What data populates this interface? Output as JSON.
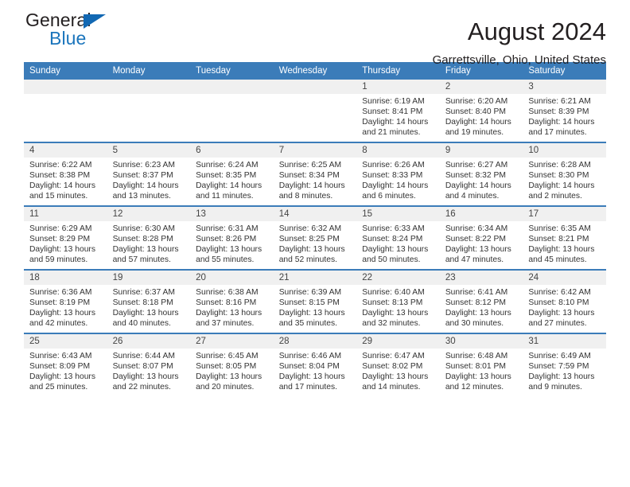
{
  "brand": {
    "name_top": "General",
    "name_bottom": "Blue",
    "color_blue": "#1b75bc",
    "triangle_icon": "triangle-icon"
  },
  "header": {
    "title": "August 2024",
    "subtitle": "Garrettsville, Ohio, United States"
  },
  "calendar": {
    "accent_color": "#3b7cb9",
    "daynum_bg": "#f0f0f0",
    "weekday_headers": [
      "Sunday",
      "Monday",
      "Tuesday",
      "Wednesday",
      "Thursday",
      "Friday",
      "Saturday"
    ],
    "weeks": [
      [
        {
          "day": "",
          "empty": true
        },
        {
          "day": "",
          "empty": true
        },
        {
          "day": "",
          "empty": true
        },
        {
          "day": "",
          "empty": true
        },
        {
          "day": "1",
          "sunrise": "Sunrise: 6:19 AM",
          "sunset": "Sunset: 8:41 PM",
          "daylight_l1": "Daylight: 14 hours",
          "daylight_l2": "and 21 minutes."
        },
        {
          "day": "2",
          "sunrise": "Sunrise: 6:20 AM",
          "sunset": "Sunset: 8:40 PM",
          "daylight_l1": "Daylight: 14 hours",
          "daylight_l2": "and 19 minutes."
        },
        {
          "day": "3",
          "sunrise": "Sunrise: 6:21 AM",
          "sunset": "Sunset: 8:39 PM",
          "daylight_l1": "Daylight: 14 hours",
          "daylight_l2": "and 17 minutes."
        }
      ],
      [
        {
          "day": "4",
          "sunrise": "Sunrise: 6:22 AM",
          "sunset": "Sunset: 8:38 PM",
          "daylight_l1": "Daylight: 14 hours",
          "daylight_l2": "and 15 minutes."
        },
        {
          "day": "5",
          "sunrise": "Sunrise: 6:23 AM",
          "sunset": "Sunset: 8:37 PM",
          "daylight_l1": "Daylight: 14 hours",
          "daylight_l2": "and 13 minutes."
        },
        {
          "day": "6",
          "sunrise": "Sunrise: 6:24 AM",
          "sunset": "Sunset: 8:35 PM",
          "daylight_l1": "Daylight: 14 hours",
          "daylight_l2": "and 11 minutes."
        },
        {
          "day": "7",
          "sunrise": "Sunrise: 6:25 AM",
          "sunset": "Sunset: 8:34 PM",
          "daylight_l1": "Daylight: 14 hours",
          "daylight_l2": "and 8 minutes."
        },
        {
          "day": "8",
          "sunrise": "Sunrise: 6:26 AM",
          "sunset": "Sunset: 8:33 PM",
          "daylight_l1": "Daylight: 14 hours",
          "daylight_l2": "and 6 minutes."
        },
        {
          "day": "9",
          "sunrise": "Sunrise: 6:27 AM",
          "sunset": "Sunset: 8:32 PM",
          "daylight_l1": "Daylight: 14 hours",
          "daylight_l2": "and 4 minutes."
        },
        {
          "day": "10",
          "sunrise": "Sunrise: 6:28 AM",
          "sunset": "Sunset: 8:30 PM",
          "daylight_l1": "Daylight: 14 hours",
          "daylight_l2": "and 2 minutes."
        }
      ],
      [
        {
          "day": "11",
          "sunrise": "Sunrise: 6:29 AM",
          "sunset": "Sunset: 8:29 PM",
          "daylight_l1": "Daylight: 13 hours",
          "daylight_l2": "and 59 minutes."
        },
        {
          "day": "12",
          "sunrise": "Sunrise: 6:30 AM",
          "sunset": "Sunset: 8:28 PM",
          "daylight_l1": "Daylight: 13 hours",
          "daylight_l2": "and 57 minutes."
        },
        {
          "day": "13",
          "sunrise": "Sunrise: 6:31 AM",
          "sunset": "Sunset: 8:26 PM",
          "daylight_l1": "Daylight: 13 hours",
          "daylight_l2": "and 55 minutes."
        },
        {
          "day": "14",
          "sunrise": "Sunrise: 6:32 AM",
          "sunset": "Sunset: 8:25 PM",
          "daylight_l1": "Daylight: 13 hours",
          "daylight_l2": "and 52 minutes."
        },
        {
          "day": "15",
          "sunrise": "Sunrise: 6:33 AM",
          "sunset": "Sunset: 8:24 PM",
          "daylight_l1": "Daylight: 13 hours",
          "daylight_l2": "and 50 minutes."
        },
        {
          "day": "16",
          "sunrise": "Sunrise: 6:34 AM",
          "sunset": "Sunset: 8:22 PM",
          "daylight_l1": "Daylight: 13 hours",
          "daylight_l2": "and 47 minutes."
        },
        {
          "day": "17",
          "sunrise": "Sunrise: 6:35 AM",
          "sunset": "Sunset: 8:21 PM",
          "daylight_l1": "Daylight: 13 hours",
          "daylight_l2": "and 45 minutes."
        }
      ],
      [
        {
          "day": "18",
          "sunrise": "Sunrise: 6:36 AM",
          "sunset": "Sunset: 8:19 PM",
          "daylight_l1": "Daylight: 13 hours",
          "daylight_l2": "and 42 minutes."
        },
        {
          "day": "19",
          "sunrise": "Sunrise: 6:37 AM",
          "sunset": "Sunset: 8:18 PM",
          "daylight_l1": "Daylight: 13 hours",
          "daylight_l2": "and 40 minutes."
        },
        {
          "day": "20",
          "sunrise": "Sunrise: 6:38 AM",
          "sunset": "Sunset: 8:16 PM",
          "daylight_l1": "Daylight: 13 hours",
          "daylight_l2": "and 37 minutes."
        },
        {
          "day": "21",
          "sunrise": "Sunrise: 6:39 AM",
          "sunset": "Sunset: 8:15 PM",
          "daylight_l1": "Daylight: 13 hours",
          "daylight_l2": "and 35 minutes."
        },
        {
          "day": "22",
          "sunrise": "Sunrise: 6:40 AM",
          "sunset": "Sunset: 8:13 PM",
          "daylight_l1": "Daylight: 13 hours",
          "daylight_l2": "and 32 minutes."
        },
        {
          "day": "23",
          "sunrise": "Sunrise: 6:41 AM",
          "sunset": "Sunset: 8:12 PM",
          "daylight_l1": "Daylight: 13 hours",
          "daylight_l2": "and 30 minutes."
        },
        {
          "day": "24",
          "sunrise": "Sunrise: 6:42 AM",
          "sunset": "Sunset: 8:10 PM",
          "daylight_l1": "Daylight: 13 hours",
          "daylight_l2": "and 27 minutes."
        }
      ],
      [
        {
          "day": "25",
          "sunrise": "Sunrise: 6:43 AM",
          "sunset": "Sunset: 8:09 PM",
          "daylight_l1": "Daylight: 13 hours",
          "daylight_l2": "and 25 minutes."
        },
        {
          "day": "26",
          "sunrise": "Sunrise: 6:44 AM",
          "sunset": "Sunset: 8:07 PM",
          "daylight_l1": "Daylight: 13 hours",
          "daylight_l2": "and 22 minutes."
        },
        {
          "day": "27",
          "sunrise": "Sunrise: 6:45 AM",
          "sunset": "Sunset: 8:05 PM",
          "daylight_l1": "Daylight: 13 hours",
          "daylight_l2": "and 20 minutes."
        },
        {
          "day": "28",
          "sunrise": "Sunrise: 6:46 AM",
          "sunset": "Sunset: 8:04 PM",
          "daylight_l1": "Daylight: 13 hours",
          "daylight_l2": "and 17 minutes."
        },
        {
          "day": "29",
          "sunrise": "Sunrise: 6:47 AM",
          "sunset": "Sunset: 8:02 PM",
          "daylight_l1": "Daylight: 13 hours",
          "daylight_l2": "and 14 minutes."
        },
        {
          "day": "30",
          "sunrise": "Sunrise: 6:48 AM",
          "sunset": "Sunset: 8:01 PM",
          "daylight_l1": "Daylight: 13 hours",
          "daylight_l2": "and 12 minutes."
        },
        {
          "day": "31",
          "sunrise": "Sunrise: 6:49 AM",
          "sunset": "Sunset: 7:59 PM",
          "daylight_l1": "Daylight: 13 hours",
          "daylight_l2": "and 9 minutes."
        }
      ]
    ]
  }
}
